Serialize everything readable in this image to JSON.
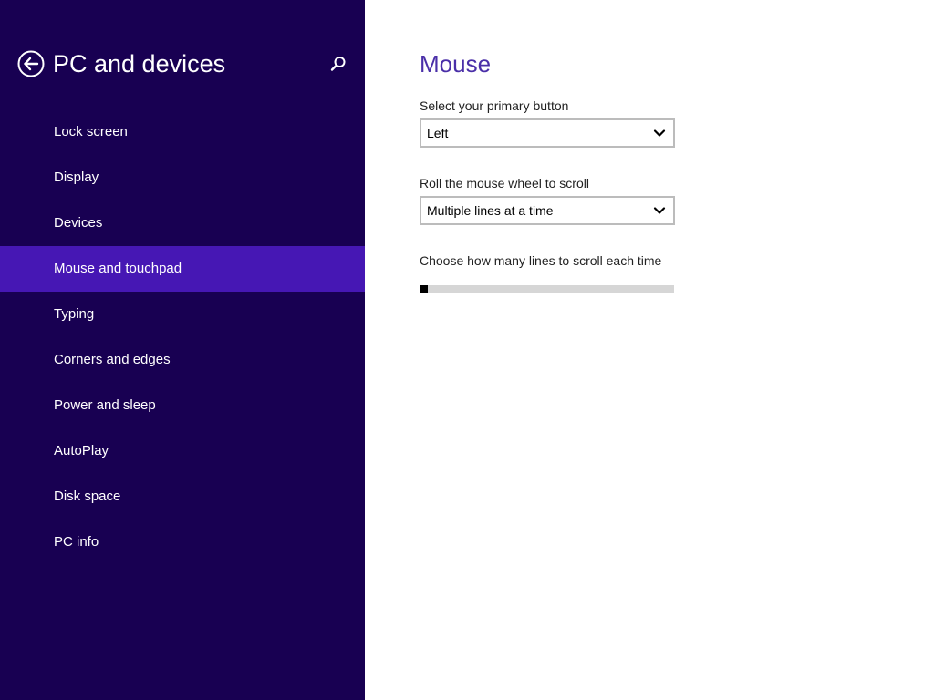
{
  "colors": {
    "sidebar_bg": "#180052",
    "selected_bg": "#4617b4",
    "title_accent": "#4a2fa8",
    "slider_track": "#d6d6d6",
    "slider_thumb": "#000000"
  },
  "header": {
    "title": "PC and devices",
    "back_icon": "back-arrow-circle-icon",
    "search_icon": "search-icon"
  },
  "sidebar": {
    "selected_index": 3,
    "items": [
      {
        "label": "Lock screen"
      },
      {
        "label": "Display"
      },
      {
        "label": "Devices"
      },
      {
        "label": "Mouse and touchpad"
      },
      {
        "label": "Typing"
      },
      {
        "label": "Corners and edges"
      },
      {
        "label": "Power and sleep"
      },
      {
        "label": "AutoPlay"
      },
      {
        "label": "Disk space"
      },
      {
        "label": "PC info"
      }
    ]
  },
  "main": {
    "title": "Mouse",
    "primary_button": {
      "label": "Select your primary button",
      "value": "Left",
      "icon": "chevron-down-icon"
    },
    "wheel_scroll": {
      "label": "Roll the mouse wheel to scroll",
      "value": "Multiple lines at a time",
      "icon": "chevron-down-icon"
    },
    "lines_slider": {
      "label": "Choose how many lines to scroll each time",
      "fraction": 0.0
    }
  }
}
